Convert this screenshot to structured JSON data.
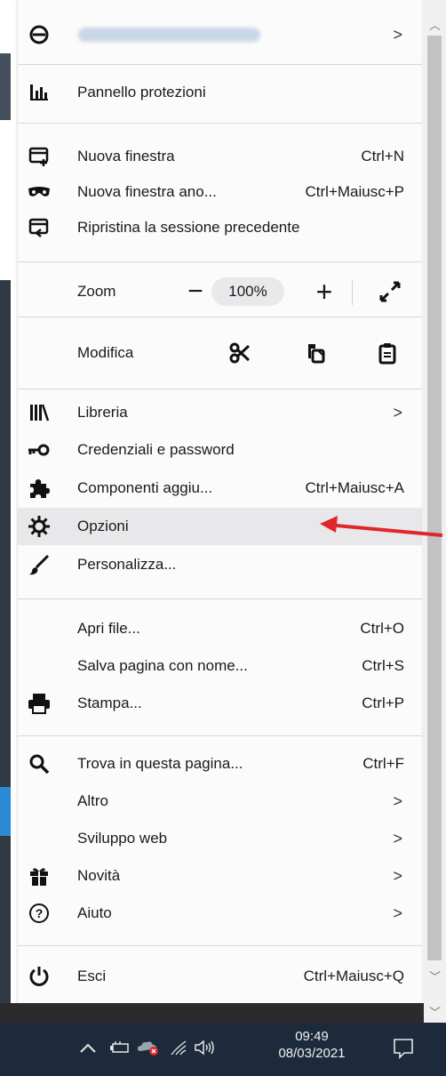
{
  "account": {
    "label": "",
    "has_submenu": true
  },
  "menu": {
    "protections": "Pannello protezioni",
    "new_window": {
      "label": "Nuova finestra",
      "shortcut": "Ctrl+N"
    },
    "private_window": {
      "label": "Nuova finestra ano...",
      "shortcut": "Ctrl+Maiusc+P"
    },
    "restore_session": {
      "label": "Ripristina la sessione precedente"
    },
    "zoom": {
      "label": "Zoom",
      "minus": "−",
      "value": "100%",
      "plus": "+"
    },
    "edit": {
      "label": "Modifica"
    },
    "library": {
      "label": "Libreria"
    },
    "logins": {
      "label": "Credenziali e password"
    },
    "addons": {
      "label": "Componenti aggiu...",
      "shortcut": "Ctrl+Maiusc+A"
    },
    "options": {
      "label": "Opzioni"
    },
    "customize": {
      "label": "Personalizza..."
    },
    "open_file": {
      "label": "Apri file...",
      "shortcut": "Ctrl+O"
    },
    "save_page": {
      "label": "Salva pagina con nome...",
      "shortcut": "Ctrl+S"
    },
    "print": {
      "label": "Stampa...",
      "shortcut": "Ctrl+P"
    },
    "find": {
      "label": "Trova in questa pagina...",
      "shortcut": "Ctrl+F"
    },
    "more": {
      "label": "Altro"
    },
    "web_dev": {
      "label": "Sviluppo web"
    },
    "whats_new": {
      "label": "Novità"
    },
    "help": {
      "label": "Aiuto"
    },
    "exit": {
      "label": "Esci",
      "shortcut": "Ctrl+Maiusc+Q"
    }
  },
  "chevron": ">",
  "taskbar": {
    "time": "09:49",
    "date": "08/03/2021"
  },
  "colors": {
    "menu_bg": "#fbfbfb",
    "highlight": "#e8e8ea",
    "arrow": "#e0262b",
    "taskbar": "#1c2a3b"
  }
}
